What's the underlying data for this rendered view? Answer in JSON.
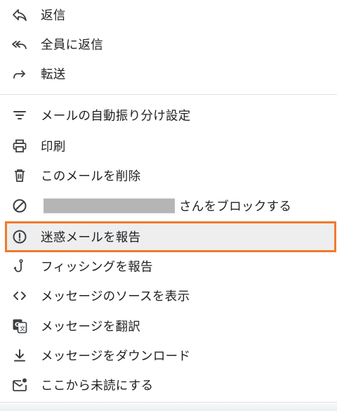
{
  "menu": {
    "reply": {
      "label": "返信",
      "icon": "reply-icon"
    },
    "reply_all": {
      "label": "全員に返信",
      "icon": "reply-all-icon"
    },
    "forward": {
      "label": "転送",
      "icon": "forward-icon"
    },
    "filter": {
      "label": "メールの自動振り分け設定",
      "icon": "filter-icon"
    },
    "print": {
      "label": "印刷",
      "icon": "print-icon"
    },
    "delete": {
      "label": "このメールを削除",
      "icon": "trash-icon"
    },
    "block": {
      "label_suffix": "さんをブロックする",
      "icon": "block-icon"
    },
    "report_spam": {
      "label": "迷惑メールを報告",
      "icon": "report-icon"
    },
    "report_phishing": {
      "label": "フィッシングを報告",
      "icon": "phishing-hook-icon"
    },
    "show_source": {
      "label": "メッセージのソースを表示",
      "icon": "code-icon"
    },
    "translate": {
      "label": "メッセージを翻訳",
      "icon": "translate-icon"
    },
    "download": {
      "label": "メッセージをダウンロード",
      "icon": "download-icon"
    },
    "mark_unread": {
      "label": "ここから未読にする",
      "icon": "mark-unread-icon"
    }
  },
  "highlight_color": "#f07a2f"
}
